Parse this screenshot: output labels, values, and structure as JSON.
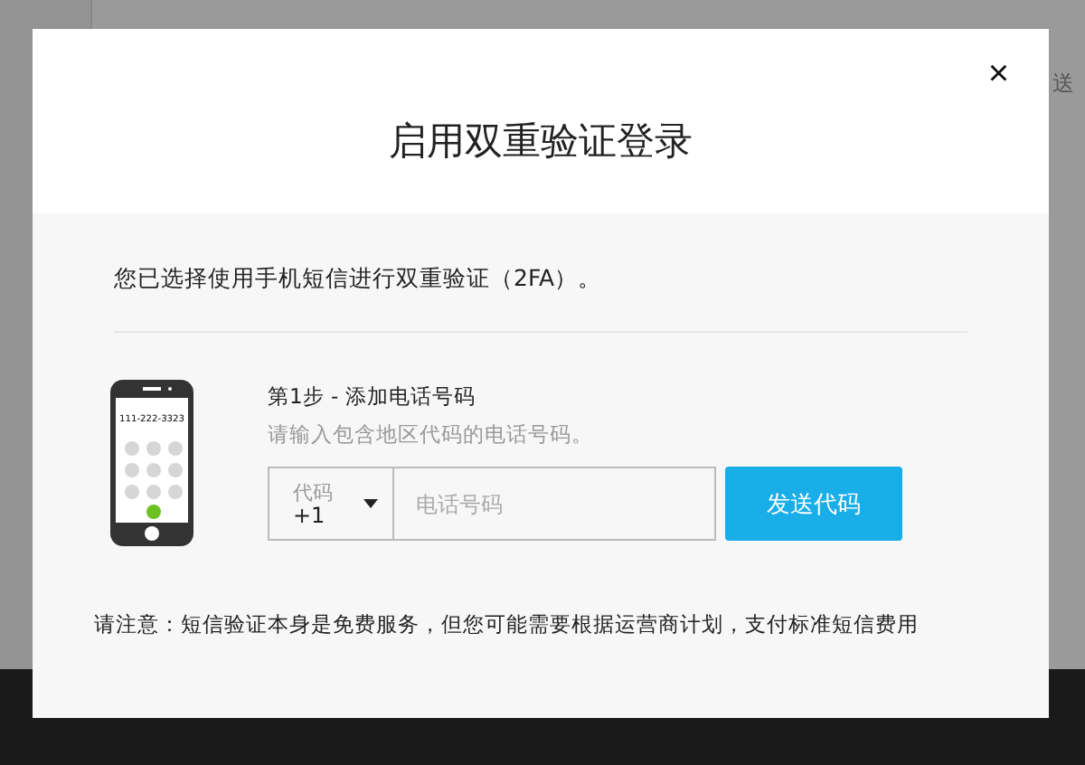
{
  "background": {
    "side_text": "送"
  },
  "dialog": {
    "close": "×",
    "title": "启用双重验证登录",
    "intro": "您已选择使用手机短信进行双重验证（2FA）。",
    "phone_illustration": {
      "number": "111-222-3323"
    },
    "step": {
      "title": "第1步 - 添加电话号码",
      "hint": "请输入包含地区代码的电话号码。",
      "country_code": {
        "label": "代码",
        "value": "+1"
      },
      "phone": {
        "placeholder": "电话号码"
      },
      "button": "发送代码"
    },
    "note": "请注意：短信验证本身是免费服务，但您可能需要根据运营商计划，支付标准短信费用"
  }
}
